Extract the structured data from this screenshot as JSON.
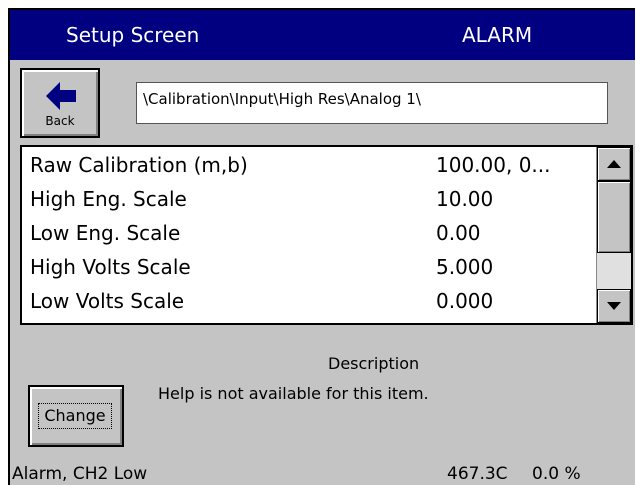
{
  "title": {
    "left": "Setup Screen",
    "right": "ALARM"
  },
  "back_button": {
    "label": "Back"
  },
  "path": "\\Calibration\\Input\\High Res\\Analog 1\\",
  "items": [
    {
      "name": "Raw Calibration (m,b)",
      "value": "100.00, 0..."
    },
    {
      "name": "High Eng. Scale",
      "value": "10.00"
    },
    {
      "name": "Low Eng. Scale",
      "value": "0.00"
    },
    {
      "name": "High Volts Scale",
      "value": "5.000"
    },
    {
      "name": "Low Volts Scale",
      "value": "0.000"
    }
  ],
  "description": {
    "title": "Description",
    "text": "Help is not available for this item."
  },
  "change_button": {
    "label": "Change"
  },
  "status": {
    "alarm": "Alarm, CH2 Low",
    "temp": "467.3C",
    "percent": "0.0 %"
  },
  "colors": {
    "titlebar": "#000080",
    "panel": "#c4c4c4",
    "back_arrow": "#000080"
  }
}
